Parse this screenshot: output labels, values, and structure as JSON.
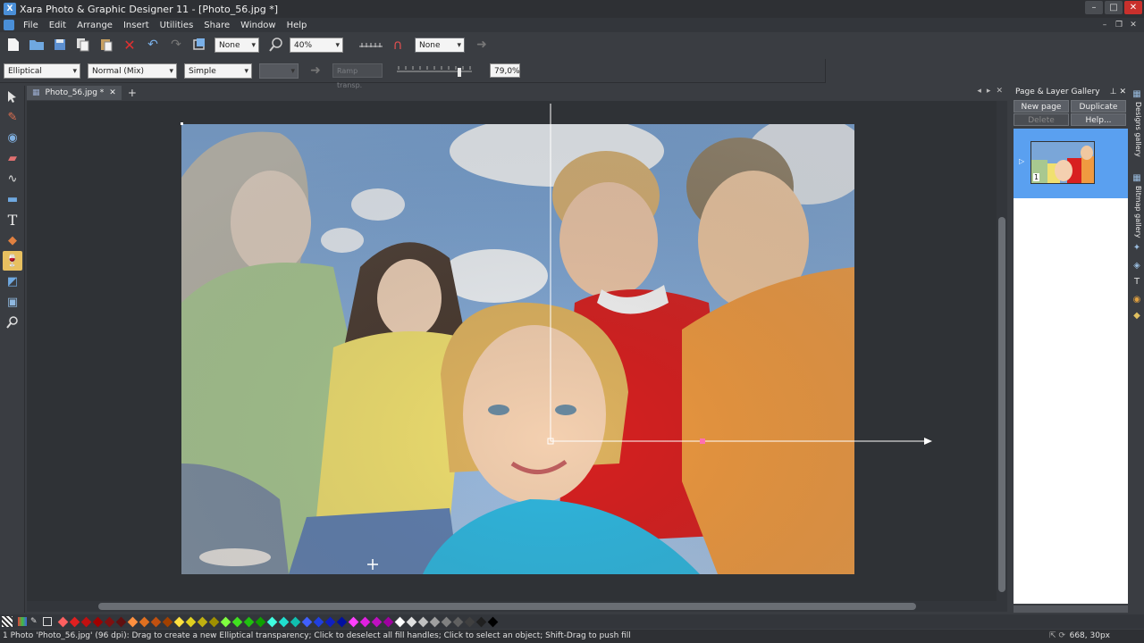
{
  "window": {
    "title": "Xara Photo & Graphic Designer 11 - [Photo_56.jpg *]",
    "controls": [
      "–",
      "□",
      "✕"
    ]
  },
  "menu": [
    "File",
    "Edit",
    "Arrange",
    "Insert",
    "Utilities",
    "Share",
    "Window",
    "Help"
  ],
  "toolbar1": {
    "quality_combo": "None",
    "zoom_combo": "40%",
    "snap_combo": "None"
  },
  "toolbar2": {
    "transparency_shape": "Elliptical",
    "transparency_type": "Normal (Mix)",
    "profile": "Simple",
    "ramp_label": "Ramp transp.",
    "percent": "79,0%"
  },
  "document": {
    "tab_label": "Photo_56.jpg *",
    "close": "✕",
    "new_tab": "+"
  },
  "gallery": {
    "title": "Page & Layer Gallery",
    "buttons": {
      "new_page": "New page",
      "duplicate": "Duplicate",
      "delete": "Delete",
      "help": "Help..."
    },
    "page_number": "1"
  },
  "side_tabs": [
    "Designs gallery",
    "Bitmap gallery"
  ],
  "status": {
    "message": "1 Photo 'Photo_56.jpg' (96 dpi): Drag to create a new Elliptical transparency; Click to deselect all fill handles; Click to select an object; Shift-Drag to push fill",
    "coords": "668, 30px"
  },
  "palette_colors": [
    "#ff6060",
    "#e02020",
    "#c01010",
    "#a00000",
    "#801010",
    "#601010",
    "#ff9040",
    "#e07020",
    "#c05010",
    "#a04000",
    "#ffe040",
    "#e0d020",
    "#c0b010",
    "#a09000",
    "#80ff40",
    "#40e020",
    "#20c010",
    "#10a000",
    "#40ffe0",
    "#20e0d0",
    "#10c0b0",
    "#4060ff",
    "#2040e0",
    "#1020c0",
    "#0010a0",
    "#ff40ff",
    "#e020e0",
    "#c010c0",
    "#a000a0",
    "#ffffff",
    "#e0e0e0",
    "#c0c0c0",
    "#a0a0a0",
    "#808080",
    "#606060",
    "#404040",
    "#202020",
    "#000000"
  ],
  "colors": {
    "accent": "#5aa0f0",
    "active_tool": "#e8c060",
    "close_red": "#c9302c"
  }
}
